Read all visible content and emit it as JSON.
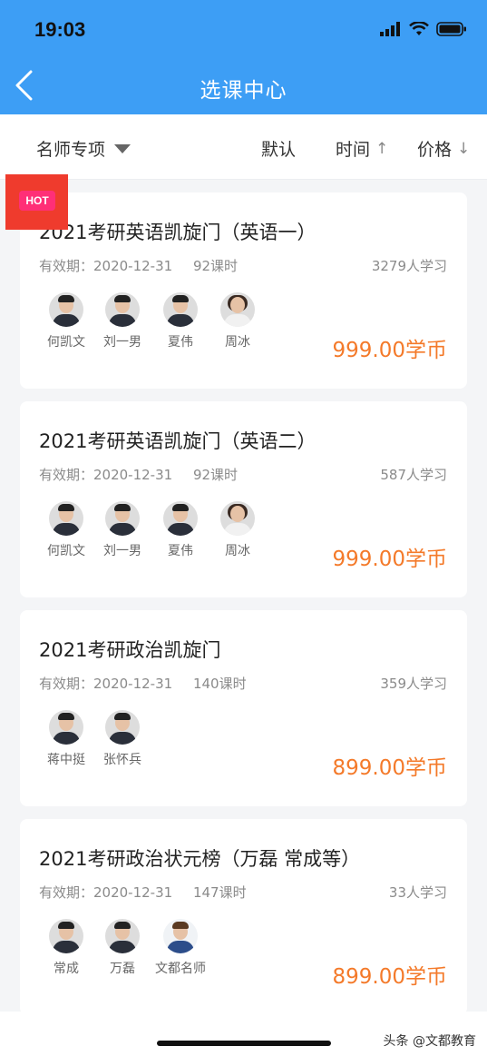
{
  "status": {
    "time": "19:03"
  },
  "nav": {
    "title": "选课中心"
  },
  "filters": {
    "category": "名师专项",
    "default": "默认",
    "time": "时间",
    "time_arrow": "↑",
    "price": "价格",
    "price_arrow": "↓"
  },
  "badge": {
    "hot": "HOT"
  },
  "courses": [
    {
      "title": "2021考研英语凯旋门（英语一）",
      "validity": "有效期：2020-12-31",
      "hours": "92课时",
      "students": "3279人学习",
      "price": "999.00学币",
      "teachers": [
        "何凯文",
        "刘一男",
        "夏伟",
        "周冰"
      ]
    },
    {
      "title": "2021考研英语凯旋门（英语二）",
      "validity": "有效期：2020-12-31",
      "hours": "92课时",
      "students": "587人学习",
      "price": "999.00学币",
      "teachers": [
        "何凯文",
        "刘一男",
        "夏伟",
        "周冰"
      ]
    },
    {
      "title": "2021考研政治凯旋门",
      "validity": "有效期：2020-12-31",
      "hours": "140课时",
      "students": "359人学习",
      "price": "899.00学币",
      "teachers": [
        "蒋中挺",
        "张怀兵"
      ]
    },
    {
      "title": "2021考研政治状元榜（万磊 常成等）",
      "validity": "有效期：2020-12-31",
      "hours": "147课时",
      "students": "33人学习",
      "price": "899.00学币",
      "teachers": [
        "常成",
        "万磊",
        "文都名师"
      ]
    }
  ],
  "watermark": "头条 @文都教育",
  "colors": {
    "header": "#3d9ef5",
    "price": "#f47a2a",
    "hot": "#ff2f77"
  }
}
